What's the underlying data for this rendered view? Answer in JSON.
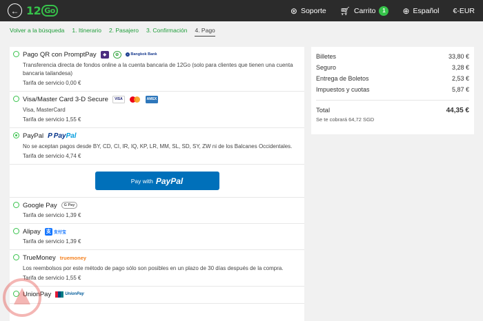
{
  "header": {
    "back_icon": "arrow-left-icon",
    "logo_main": "12",
    "logo_go": "Go",
    "support": "Soporte",
    "cart": "Carrito",
    "cart_count": "1",
    "language": "Español",
    "currency": "€-EUR"
  },
  "breadcrumb": [
    {
      "label": "Volver a la búsqueda"
    },
    {
      "label": "1. Itinerario"
    },
    {
      "label": "2. Pasajero"
    },
    {
      "label": "3. Confirmación"
    },
    {
      "label": "4. Pago"
    }
  ],
  "methods": {
    "promptpay": {
      "title": "Pago QR con PromptPay",
      "logo_text": "Bangkok Bank",
      "desc": "Transferencia directa de fondos online a la cuenta bancaria de 12Go (solo para clientes que tienen una cuenta bancaria tailandesa)",
      "fee": "Tarifa de servicio 0,00 €"
    },
    "visa": {
      "title": "Visa/Master Card 3-D Secure",
      "visa_logo": "VISA",
      "amex_logo": "AMEX",
      "desc": "Visa, MasterCard",
      "fee": "Tarifa de servicio 1,55 €"
    },
    "paypal": {
      "title": "PayPal",
      "logo_pay": "Pay",
      "logo_pal": "Pal",
      "desc": "No se aceptan pagos desde BY, CD, CI, IR, IQ, KP, LR, MM, SL, SD, SY, ZW ni de los Balcanes Occidentales.",
      "fee": "Tarifa de servicio 4,74 €",
      "button_prefix": "Pay with",
      "button_brand": "PayPal"
    },
    "googlepay": {
      "title": "Google Pay",
      "logo_text": "G Pay",
      "fee": "Tarifa de servicio 1,39 €"
    },
    "alipay": {
      "title": "Alipay",
      "logo_icon": "支",
      "logo_text": "支付宝",
      "fee": "Tarifa de servicio 1,39 €"
    },
    "truemoney": {
      "title": "TrueMoney",
      "logo_text": "truemoney",
      "desc": "Los reembolsos por este método de pago sólo son posibles en un plazo de 30 días después de la compra.",
      "fee": "Tarifa de servicio 1,55 €"
    },
    "unionpay": {
      "title": "UnionPay",
      "logo_text": "UnionPay"
    }
  },
  "summary": {
    "rows": [
      {
        "label": "Billetes",
        "value": "33,80 €"
      },
      {
        "label": "Seguro",
        "value": "3,28 €"
      },
      {
        "label": "Entrega de Boletos",
        "value": "2,53 €"
      },
      {
        "label": "Impuestos y cuotas",
        "value": "5,87 €"
      }
    ],
    "total_label": "Total",
    "total_value": "44,35 €",
    "charged_note": "Se te cobrará 64,72 SGD"
  },
  "colors": {
    "accent": "#36c24a",
    "topbar": "#2b2b2b",
    "paypal_button": "#0070ba"
  }
}
